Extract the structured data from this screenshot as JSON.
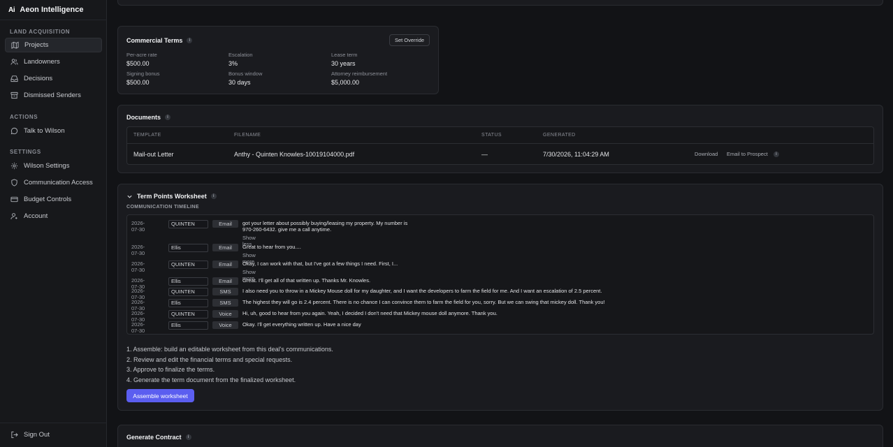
{
  "app": {
    "logo": "Ai",
    "name": "Aeon Intelligence"
  },
  "sidebar": {
    "sections": [
      {
        "label": "LAND ACQUISITION",
        "items": [
          "Projects",
          "Landowners",
          "Decisions",
          "Dismissed Senders"
        ]
      },
      {
        "label": "ACTIONS",
        "items": [
          "Talk to Wilson"
        ]
      },
      {
        "label": "SETTINGS",
        "items": [
          "Wilson Settings",
          "Communication Access",
          "Budget Controls",
          "Account"
        ]
      }
    ],
    "active_item": "Projects",
    "sign_out": "Sign Out"
  },
  "commercial_terms": {
    "title": "Commercial Terms",
    "override_button": "Set Override",
    "fields": [
      {
        "label": "Per-acre rate",
        "value": "$500.00"
      },
      {
        "label": "Escalation",
        "value": "3%"
      },
      {
        "label": "Lease term",
        "value": "30 years"
      },
      {
        "label": "Signing bonus",
        "value": "$500.00"
      },
      {
        "label": "Bonus window",
        "value": "30 days"
      },
      {
        "label": "Attorney reimbursement",
        "value": "$5,000.00"
      }
    ]
  },
  "documents": {
    "title": "Documents",
    "columns": [
      "TEMPLATE",
      "FILENAME",
      "STATUS",
      "GENERATED"
    ],
    "rows": [
      {
        "template": "Mail-out Letter",
        "filename": "Anthy - Quinten Knowles-10019104000.pdf",
        "status": "—",
        "generated": "7/30/2026, 11:04:29 AM",
        "download": "Download",
        "email": "Email to Prospect"
      }
    ]
  },
  "worksheet": {
    "title": "Term Points Worksheet",
    "timeline_label": "COMMUNICATION TIMELINE",
    "timeline": [
      {
        "date": "2026-07-30",
        "name": "QUINTEN",
        "channel": "Email",
        "message": "got your letter about possibly buying/leasing my property. My number is",
        "message2": "970-260-6432. give me a call anytime.",
        "toggle": "Show less"
      },
      {
        "date": "2026-07-30",
        "name": "Ellis",
        "channel": "Email",
        "message": "Great to hear from you....",
        "toggle": "Show more"
      },
      {
        "date": "2026-07-30",
        "name": "QUINTEN",
        "channel": "Email",
        "message": "Okay, I can work with that, but I've got a few things I need. First, I...",
        "toggle": "Show more"
      },
      {
        "date": "2026-07-30",
        "name": "Ellis",
        "channel": "Email",
        "message": "Great. I'll get all of that written up. Thanks Mr. Knowles."
      },
      {
        "date": "2026-07-30",
        "name": "QUINTEN",
        "channel": "SMS",
        "message": "I also need you to throw in a Mickey Mouse doll for my daughter, and I want the developers to farm the field for me. And I want an escalation of 2.5 percent."
      },
      {
        "date": "2026-07-30",
        "name": "Ellis",
        "channel": "SMS",
        "message": "The highest they will go is 2.4 percent. There is no chance I can convince them to farm the field for you, sorry. But we can swing that mickey doll. Thank you!"
      },
      {
        "date": "2026-07-30",
        "name": "QUINTEN",
        "channel": "Voice",
        "message": "Hi, uh, good to hear from you again. Yeah, I decided I don't need that Mickey mouse doll anymore. Thank you."
      },
      {
        "date": "2026-07-30",
        "name": "Ellis",
        "channel": "Voice",
        "message": "Okay. I'll get everything written up. Have a nice day"
      }
    ],
    "steps": [
      "1. Assemble: build an editable worksheet from this deal's communications.",
      "2. Review and edit the financial terms and special requests.",
      "3. Approve to finalize the terms.",
      "4. Generate the term document from the finalized worksheet."
    ],
    "assemble_button": "Assemble worksheet"
  },
  "generate_contract": {
    "title": "Generate Contract"
  },
  "info_glyph": "i"
}
